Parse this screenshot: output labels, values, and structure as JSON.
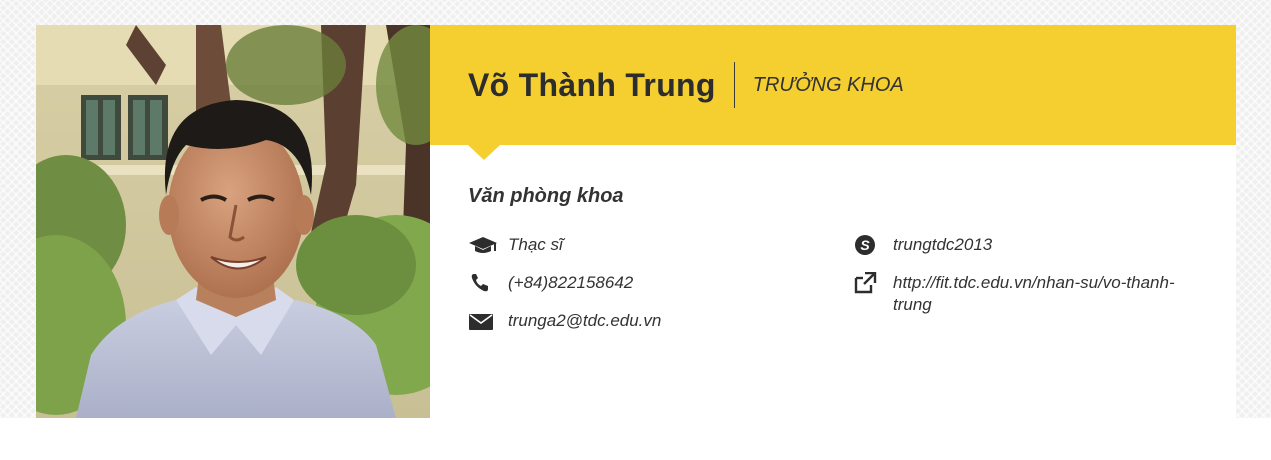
{
  "profile": {
    "name": "Võ Thành Trung",
    "role": "TRƯỞNG KHOA",
    "department": "Văn phòng khoa",
    "degree": "Thạc sĩ",
    "phone": "(+84)822158642",
    "email": "trunga2@tdc.edu.vn",
    "skype": "trungtdc2013",
    "website": "http://fit.tdc.edu.vn/nhan-su/vo-thanh-trung"
  },
  "colors": {
    "accent": "#f4cf2f",
    "text": "#333333"
  },
  "icons": {
    "degree": "graduation-cap-icon",
    "phone": "phone-icon",
    "email": "envelope-icon",
    "skype": "skype-icon",
    "website": "external-link-icon"
  }
}
